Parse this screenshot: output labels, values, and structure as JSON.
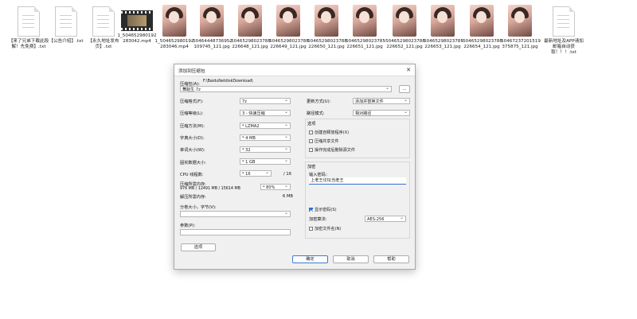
{
  "files": [
    {
      "name": "【来了兄弟下载此段解！先免费】.txt",
      "kind": "doc"
    },
    {
      "name": "【公告介绍】.txt",
      "kind": "doc"
    },
    {
      "name": "【永久地址发布页】.txt",
      "kind": "doc"
    },
    {
      "name": "1_504652980192283042.mp4",
      "kind": "video"
    },
    {
      "name": "1_504652980192283046.mp4",
      "kind": "photo"
    },
    {
      "name": "-50464448736952109745_121.jpg",
      "kind": "photo"
    },
    {
      "name": "-50465298023785226648_121.jpg",
      "kind": "photo"
    },
    {
      "name": "-50465298023785226649_121.jpg",
      "kind": "photo"
    },
    {
      "name": "-50465298023785226650_121.jpg",
      "kind": "photo"
    },
    {
      "name": "-50465298023785226651_121.jpg",
      "kind": "photo"
    },
    {
      "name": "-50465298023785226652_121.jpg",
      "kind": "photo"
    },
    {
      "name": "-50465298023785226653_121.jpg",
      "kind": "photo"
    },
    {
      "name": "-50465298023785226654_121.jpg",
      "kind": "photo"
    },
    {
      "name": "-50467237201519375875_121.jpg",
      "kind": "photo"
    },
    {
      "name": "最新地址及APP请加邮箱自动获取！！！.txt",
      "kind": "doc"
    }
  ],
  "dialog": {
    "title": "添加到压缩包",
    "close_glyph": "✕",
    "archive_label": "压缩包(A):",
    "archive_dir": "F:\\BaiduNetdiskDownload\\",
    "archive_name": "舞蹈生.7z",
    "browse_label": "...",
    "left": {
      "format_label": "压缩格式(F):",
      "format_value": "7z",
      "level_label": "压缩等级(L):",
      "level_value": "3 - 快速压缩",
      "method_label": "压缩方法(M):",
      "method_value": "* LZMA2",
      "dict_label": "字典大小(D):",
      "dict_value": "* 4 MB",
      "word_label": "单词大小(W):",
      "word_value": "* 32",
      "solid_label": "固实数据大小:",
      "solid_value": "* 1 GB",
      "threads_label": "CPU 线程数:",
      "threads_value": "* 16",
      "threads_total": "/ 16",
      "mem_label": "压缩所需内存:",
      "mem_value": "976 MB / 12491 MB / 15614 MB",
      "mem_percent": "* 80%",
      "decomp_label": "解压所需内存:",
      "decomp_value": "6 MB",
      "split_label": "分卷大小，字节(V):",
      "params_label": "参数(P):",
      "options_button": "选项"
    },
    "right": {
      "update_label": "更新方式(U):",
      "update_value": "添加并替换文件",
      "pathmode_label": "路径模式:",
      "pathmode_value": "相对路径",
      "options_title": "选项",
      "opt_sfx": "创建自释放程序(X)",
      "opt_shared": "压缩共享文件",
      "opt_delete": "操作完成后删除源文件",
      "encrypt_title": "加密",
      "pwd_label": "输入密码：",
      "pwd_value": "上老王论坛当老王",
      "show_pwd": "显示密码(S)",
      "enc_method_label": "加密算法:",
      "enc_method_value": "AES-256",
      "encrypt_names": "加密文件名(N)"
    },
    "ok": "确定",
    "cancel": "取消",
    "help": "帮助"
  }
}
